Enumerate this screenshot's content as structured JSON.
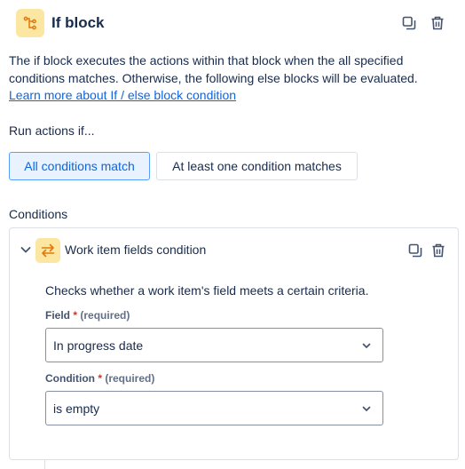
{
  "header": {
    "title": "If block",
    "icon": "branch-icon",
    "actions": [
      "duplicate-icon",
      "delete-icon"
    ]
  },
  "description": {
    "text": "The if block executes the actions within that block when the all specified conditions matches. Otherwise, the following else blocks will be evaluated.",
    "link": "Learn more about If / else block condition"
  },
  "run_actions": {
    "label": "Run actions if...",
    "options": [
      "All conditions match",
      "At least one condition matches"
    ],
    "selected": "All conditions match"
  },
  "conditions": {
    "label": "Conditions",
    "items": [
      {
        "title": "Work item fields condition",
        "icon": "swap-arrows-icon",
        "description": "Checks whether a work item's field meets a certain criteria.",
        "field": {
          "label": "Field",
          "required_marker": "*",
          "required_text": "(required)",
          "value": "In progress date"
        },
        "condition": {
          "label": "Condition",
          "required_marker": "*",
          "required_text": "(required)",
          "value": "is empty"
        }
      }
    ]
  },
  "colors": {
    "accent": "#0c66e4",
    "icon_bg": "#fbe7a1",
    "icon_fg": "#e2770a",
    "required": "#c9372c"
  }
}
